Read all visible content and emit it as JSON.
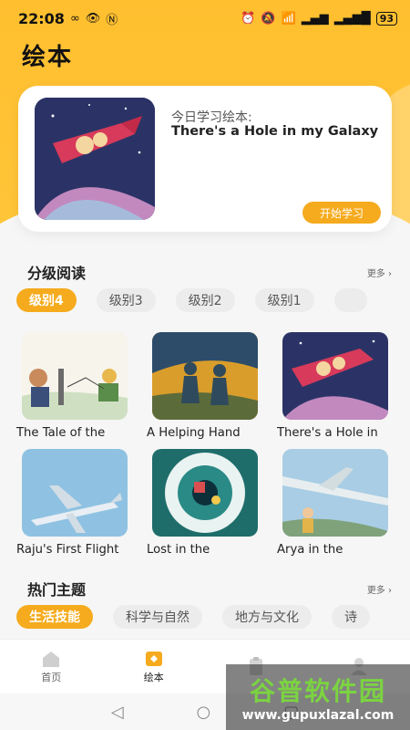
{
  "status_bar": {
    "time": "22:08",
    "battery": "93"
  },
  "page_title": "绘本",
  "today": {
    "label": "今日学习绘本:",
    "book_title": "There's a Hole in my Galaxy",
    "start_label": "开始学习"
  },
  "graded_reading": {
    "title": "分级阅读",
    "more": "更多 ›",
    "levels": [
      "级别4",
      "级别3",
      "级别2",
      "级别1"
    ],
    "books": [
      {
        "title": "The Tale of the",
        "cover": "tale-cover"
      },
      {
        "title": "A Helping Hand",
        "cover": "helping-hand-cover"
      },
      {
        "title": "There's a Hole in",
        "cover": "galaxy-cover"
      },
      {
        "title": "Raju's First Flight",
        "cover": "raju-cover"
      },
      {
        "title": "Lost in the",
        "cover": "lost-cover"
      },
      {
        "title": "Arya in the",
        "cover": "arya-cover"
      }
    ]
  },
  "hot_topics": {
    "title": "热门主题",
    "more": "更多 ›",
    "topics": [
      "生活技能",
      "科学与自然",
      "地方与文化",
      "诗"
    ]
  },
  "nav": {
    "items": [
      {
        "label": "首页",
        "icon": "home-icon"
      },
      {
        "label": "绘本",
        "icon": "picture-book-icon"
      },
      {
        "label": "",
        "icon": "clipboard-icon"
      },
      {
        "label": "",
        "icon": "profile-icon"
      }
    ]
  },
  "watermark": {
    "big": "谷普软件园",
    "small": "www.gupuxlazal.com"
  },
  "colors": {
    "accent": "#f5ab1d",
    "header": "#ffc233"
  }
}
